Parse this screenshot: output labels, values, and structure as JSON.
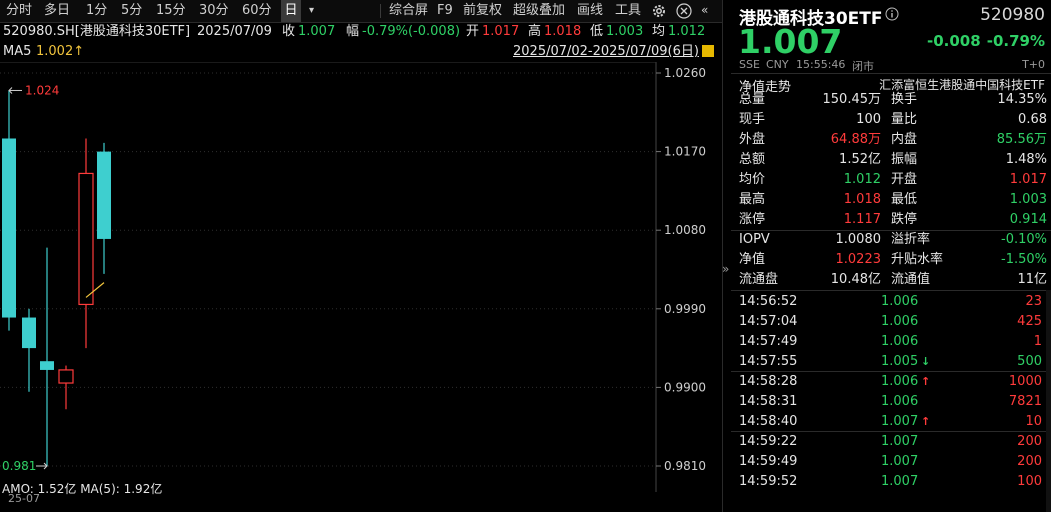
{
  "toolbar": {
    "items": [
      "分时",
      "多日",
      "1分",
      "5分",
      "15分",
      "30分",
      "60分",
      "日",
      "▾",
      "综合屏",
      "F9",
      "前复权",
      "超级叠加",
      "画线",
      "工具"
    ],
    "active": "日"
  },
  "quote": {
    "code_name": "520980.SH[港股通科技30ETF]",
    "date": "2025/07/09",
    "close_label": "收",
    "close_value": "1.007",
    "change_label": "幅",
    "change_value": "-0.79%(-0.008)",
    "open_label": "开",
    "open_value": "1.017",
    "high_label": "高",
    "high_value": "1.018",
    "low_label": "低",
    "low_value": "1.003",
    "avg_label": "均",
    "avg_value": "1.012"
  },
  "ma": {
    "label": "MA5",
    "value": "1.002↑"
  },
  "range_text": "2025/07/02-2025/07/09(6日)",
  "chart": {
    "price_axis": [
      "1.0260",
      "1.0170",
      "1.0080",
      "0.9990",
      "0.9900",
      "0.9810"
    ],
    "high_marker": "1.024",
    "low_marker": "0.981",
    "volume_text": "AMO: 1.52亿  MA(5): 1.92亿",
    "x_label": "25-07"
  },
  "chart_data": {
    "type": "candlestick",
    "y_axis_ticks": [
      1.026,
      1.017,
      1.008,
      0.999,
      0.99,
      0.981
    ],
    "ylim": [
      0.98,
      1.0275
    ],
    "candles": [
      {
        "open": 1.0185,
        "high": 1.024,
        "low": 0.9965,
        "close": 0.998,
        "direction": "down"
      },
      {
        "open": 0.998,
        "high": 0.999,
        "low": 0.9895,
        "close": 0.9945,
        "direction": "down"
      },
      {
        "open": 0.993,
        "high": 1.006,
        "low": 0.981,
        "close": 0.992,
        "direction": "down"
      },
      {
        "open": 0.9905,
        "high": 0.9925,
        "low": 0.9875,
        "close": 0.992,
        "direction": "up"
      },
      {
        "open": 0.9995,
        "high": 1.0185,
        "low": 0.9945,
        "close": 1.0145,
        "direction": "up"
      },
      {
        "open": 1.017,
        "high": 1.018,
        "low": 1.003,
        "close": 1.007,
        "direction": "down"
      }
    ],
    "ma5": [
      {
        "index": 4,
        "value": 1.0003
      },
      {
        "index": 5,
        "value": 1.002
      }
    ]
  },
  "panel": {
    "title": "港股通科技30ETF",
    "code": "520980",
    "price": "1.007",
    "change": "-0.008",
    "change_pct": "-0.79%",
    "meta": [
      "SSE",
      "CNY",
      "15:55:46",
      "闭市"
    ],
    "t_label": "T+0",
    "trend_label": "净值走势",
    "fund_name": "汇添富恒生港股通中国科技ETF",
    "stats": [
      {
        "l1": "总量",
        "v1": "150.45万",
        "c1": "wht",
        "l2": "换手",
        "v2": "14.35%",
        "c2": "wht"
      },
      {
        "l1": "现手",
        "v1": "100",
        "c1": "wht",
        "l2": "量比",
        "v2": "0.68",
        "c2": "wht"
      },
      {
        "l1": "外盘",
        "v1": "64.88万",
        "c1": "red",
        "l2": "内盘",
        "v2": "85.56万",
        "c2": "grn"
      },
      {
        "l1": "总额",
        "v1": "1.52亿",
        "c1": "wht",
        "l2": "振幅",
        "v2": "1.48%",
        "c2": "wht"
      },
      {
        "l1": "均价",
        "v1": "1.012",
        "c1": "grn",
        "l2": "开盘",
        "v2": "1.017",
        "c2": "red"
      },
      {
        "l1": "最高",
        "v1": "1.018",
        "c1": "red",
        "l2": "最低",
        "v2": "1.003",
        "c2": "grn"
      },
      {
        "l1": "涨停",
        "v1": "1.117",
        "c1": "red",
        "l2": "跌停",
        "v2": "0.914",
        "c2": "grn"
      }
    ],
    "stats2": [
      {
        "l1": "IOPV",
        "v1": "1.0080",
        "c1": "wht",
        "l2": "溢折率",
        "v2": "-0.10%",
        "c2": "grn"
      },
      {
        "l1": "净值",
        "v1": "1.0223",
        "c1": "red",
        "l2": "升贴水率",
        "v2": "-1.50%",
        "c2": "grn"
      },
      {
        "l1": "流通盘",
        "v1": "10.48亿",
        "c1": "wht",
        "l2": "流通值",
        "v2": "11亿",
        "c2": "wht"
      }
    ],
    "trades": [
      {
        "time": "14:56:52",
        "price": "1.006",
        "arrow": "",
        "vol": "23"
      },
      {
        "time": "14:57:04",
        "price": "1.006",
        "arrow": "",
        "vol": "425"
      },
      {
        "time": "14:57:49",
        "price": "1.006",
        "arrow": "",
        "vol": "1"
      },
      {
        "time": "14:57:55",
        "price": "1.005",
        "arrow": "down",
        "vol": "500"
      },
      {
        "time": "14:58:28",
        "price": "1.006",
        "arrow": "up",
        "vol": "1000"
      },
      {
        "time": "14:58:31",
        "price": "1.006",
        "arrow": "",
        "vol": "7821"
      },
      {
        "time": "14:58:40",
        "price": "1.007",
        "arrow": "up",
        "vol": "10"
      },
      {
        "time": "14:59:22",
        "price": "1.007",
        "arrow": "",
        "vol": "200"
      },
      {
        "time": "14:59:49",
        "price": "1.007",
        "arrow": "",
        "vol": "200"
      },
      {
        "time": "14:59:52",
        "price": "1.007",
        "arrow": "",
        "vol": "100"
      }
    ]
  },
  "colors": {
    "up": "#ff3b3b",
    "down": "#3ecfcf",
    "green": "#2fd066",
    "bg": "#000000"
  }
}
